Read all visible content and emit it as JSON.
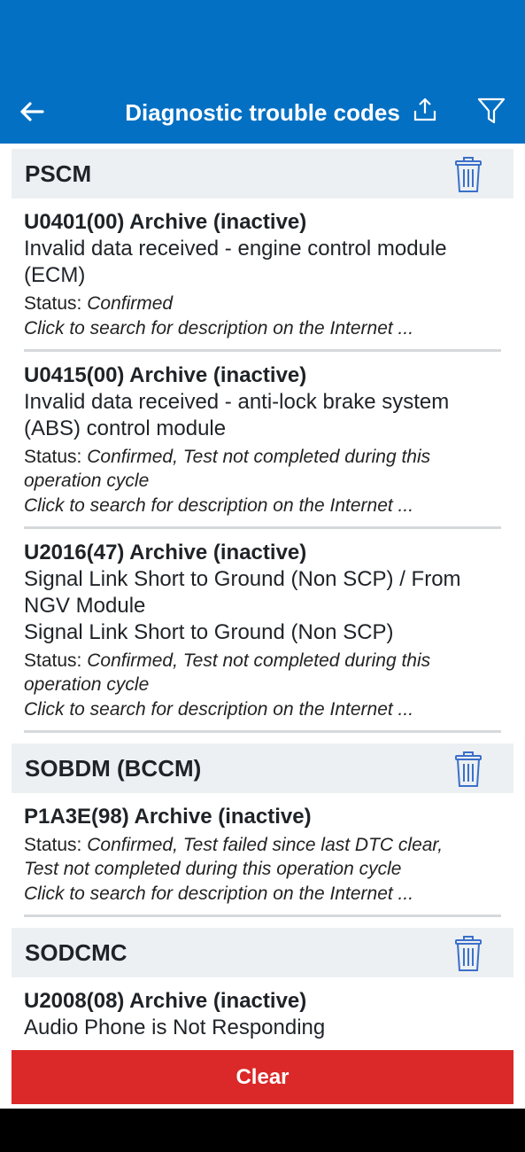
{
  "appbar": {
    "title": "Diagnostic trouble codes",
    "back_icon": "arrow-left-icon",
    "share_icon": "share-icon",
    "filter_icon": "filter-icon",
    "color": "#0470c3"
  },
  "modules": [
    {
      "name": "PSCM",
      "dtcs": [
        {
          "code": "U0401(00) Archive (inactive)",
          "desc": [
            "Invalid data received - engine control module",
            "(ECM)"
          ],
          "status_label": "Status:",
          "status_value": "Confirmed",
          "status_value_line2": "",
          "search": "Click to search for description on the Internet ..."
        },
        {
          "code": "U0415(00) Archive (inactive)",
          "desc": [
            "Invalid data received - anti-lock brake system",
            "(ABS) control module"
          ],
          "status_label": "Status:",
          "status_value": "Confirmed, Test not completed during this",
          "status_value_line2": "operation cycle",
          "search": "Click to search for description on the Internet ..."
        },
        {
          "code": "U2016(47) Archive (inactive)",
          "desc": [
            "Signal Link Short to Ground (Non SCP) / From",
            "NGV Module",
            "Signal Link Short to Ground (Non SCP)"
          ],
          "status_label": "Status:",
          "status_value": "Confirmed, Test not completed during this",
          "status_value_line2": "operation cycle",
          "search": "Click to search for description on the Internet ..."
        }
      ]
    },
    {
      "name": "SOBDM (BCCM)",
      "dtcs": [
        {
          "code": "P1A3E(98) Archive (inactive)",
          "desc": [],
          "status_label": "Status:",
          "status_value": "Confirmed, Test failed since last DTC clear,",
          "status_value_line2": "Test not completed during this operation cycle",
          "search": "Click to search for description on the Internet ..."
        }
      ]
    },
    {
      "name": "SODCMC",
      "dtcs": [
        {
          "code": "U2008(08) Archive (inactive)",
          "desc": [
            "Audio Phone is Not Responding"
          ]
        }
      ]
    }
  ],
  "clear_button": {
    "label": "Clear",
    "color": "#db2828"
  }
}
